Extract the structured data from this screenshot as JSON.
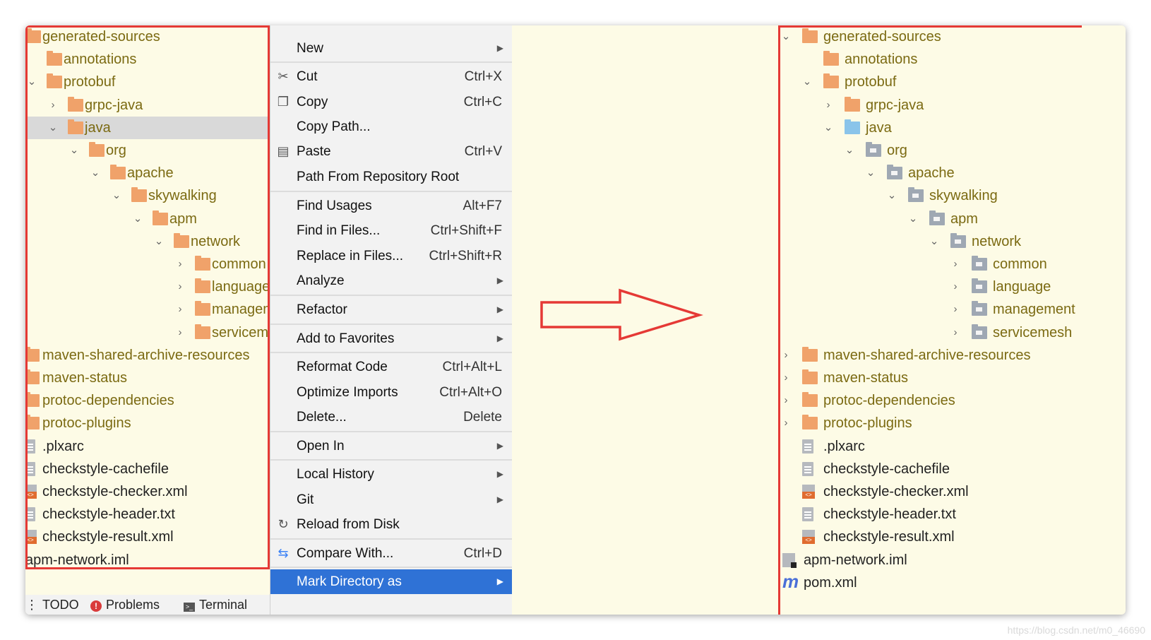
{
  "left_tree": {
    "rows": [
      {
        "label": "generated-sources",
        "icon": "folder-icon"
      },
      {
        "label": "annotations",
        "icon": "folder-icon"
      },
      {
        "label": "protobuf",
        "icon": "folder-icon",
        "chev": "v"
      },
      {
        "label": "grpc-java",
        "icon": "folder-icon",
        "chev": ">"
      },
      {
        "label": "java",
        "icon": "folder-icon",
        "chev": "v"
      },
      {
        "label": "org",
        "icon": "folder-icon",
        "chev": "v"
      },
      {
        "label": "apache",
        "icon": "folder-icon",
        "chev": "v"
      },
      {
        "label": "skywalking",
        "icon": "folder-icon",
        "chev": "v"
      },
      {
        "label": "apm",
        "icon": "folder-icon",
        "chev": "v"
      },
      {
        "label": "network",
        "icon": "folder-icon",
        "chev": "v"
      },
      {
        "label": "common",
        "icon": "folder-icon",
        "chev": ">"
      },
      {
        "label": "language",
        "icon": "folder-icon",
        "chev": ">"
      },
      {
        "label": "managem",
        "icon": "folder-icon",
        "chev": ">"
      },
      {
        "label": "serviceme",
        "icon": "folder-icon",
        "chev": ">"
      },
      {
        "label": "maven-shared-archive-resources",
        "icon": "folder-icon"
      },
      {
        "label": "maven-status",
        "icon": "folder-icon"
      },
      {
        "label": "protoc-dependencies",
        "icon": "folder-icon"
      },
      {
        "label": "protoc-plugins",
        "icon": "folder-icon"
      },
      {
        "label": ".plxarc",
        "icon": "file-icon"
      },
      {
        "label": "checkstyle-cachefile",
        "icon": "file-icon"
      },
      {
        "label": "checkstyle-checker.xml",
        "icon": "xml-file-icon"
      },
      {
        "label": "checkstyle-header.txt",
        "icon": "file-icon"
      },
      {
        "label": "checkstyle-result.xml",
        "icon": "xml-file-icon"
      },
      {
        "label": "apm-network.iml",
        "icon": "none"
      }
    ]
  },
  "bottom_bar": {
    "todo": "TODO",
    "problems": "Problems",
    "terminal": "Terminal"
  },
  "menu": {
    "items": [
      {
        "label": "New",
        "submenu": true
      },
      {
        "label": "Cut",
        "shortcut": "Ctrl+X",
        "icon": "scissors-icon"
      },
      {
        "label": "Copy",
        "shortcut": "Ctrl+C",
        "icon": "copy-icon"
      },
      {
        "label": "Copy Path...",
        "shortcut": ""
      },
      {
        "label": "Paste",
        "shortcut": "Ctrl+V",
        "icon": "clipboard-icon"
      },
      {
        "label": "Path From Repository Root",
        "shortcut": ""
      },
      {
        "label": "Find Usages",
        "shortcut": "Alt+F7"
      },
      {
        "label": "Find in Files...",
        "shortcut": "Ctrl+Shift+F"
      },
      {
        "label": "Replace in Files...",
        "shortcut": "Ctrl+Shift+R"
      },
      {
        "label": "Analyze",
        "submenu": true
      },
      {
        "label": "Refactor",
        "submenu": true
      },
      {
        "label": "Add to Favorites",
        "submenu": true
      },
      {
        "label": "Reformat Code",
        "shortcut": "Ctrl+Alt+L"
      },
      {
        "label": "Optimize Imports",
        "shortcut": "Ctrl+Alt+O"
      },
      {
        "label": "Delete...",
        "shortcut": "Delete"
      },
      {
        "label": "Open In",
        "submenu": true
      },
      {
        "label": "Local History",
        "submenu": true
      },
      {
        "label": "Git",
        "submenu": true
      },
      {
        "label": "Reload from Disk",
        "icon": "reload-icon"
      },
      {
        "label": "Compare With...",
        "shortcut": "Ctrl+D",
        "icon": "compare-icon"
      },
      {
        "label": "Mark Directory as",
        "submenu": true,
        "active": true
      }
    ]
  },
  "right_tree": {
    "rows": [
      {
        "label": "generated-sources",
        "icon": "folder-icon",
        "chev": "v"
      },
      {
        "label": "annotations",
        "icon": "folder-icon"
      },
      {
        "label": "protobuf",
        "icon": "folder-icon",
        "chev": "v"
      },
      {
        "label": "grpc-java",
        "icon": "folder-icon",
        "chev": ">"
      },
      {
        "label": "java",
        "icon": "source-root-folder-icon",
        "chev": "v"
      },
      {
        "label": "org",
        "icon": "package-icon",
        "chev": "v"
      },
      {
        "label": "apache",
        "icon": "package-icon",
        "chev": "v"
      },
      {
        "label": "skywalking",
        "icon": "package-icon",
        "chev": "v"
      },
      {
        "label": "apm",
        "icon": "package-icon",
        "chev": "v"
      },
      {
        "label": "network",
        "icon": "package-icon",
        "chev": "v"
      },
      {
        "label": "common",
        "icon": "package-icon",
        "chev": ">"
      },
      {
        "label": "language",
        "icon": "package-icon",
        "chev": ">"
      },
      {
        "label": "management",
        "icon": "package-icon",
        "chev": ">"
      },
      {
        "label": "servicemesh",
        "icon": "package-icon",
        "chev": ">"
      },
      {
        "label": "maven-shared-archive-resources",
        "icon": "folder-icon",
        "chev": ">"
      },
      {
        "label": "maven-status",
        "icon": "folder-icon",
        "chev": ">"
      },
      {
        "label": "protoc-dependencies",
        "icon": "folder-icon",
        "chev": ">"
      },
      {
        "label": "protoc-plugins",
        "icon": "folder-icon",
        "chev": ">"
      },
      {
        "label": ".plxarc",
        "icon": "file-icon"
      },
      {
        "label": "checkstyle-cachefile",
        "icon": "file-icon"
      },
      {
        "label": "checkstyle-checker.xml",
        "icon": "xml-file-icon"
      },
      {
        "label": "checkstyle-header.txt",
        "icon": "file-icon"
      },
      {
        "label": "checkstyle-result.xml",
        "icon": "xml-file-icon"
      },
      {
        "label": "apm-network.iml",
        "icon": "iml-file-icon"
      },
      {
        "label": "pom.xml",
        "icon": "maven-icon"
      }
    ]
  },
  "caption": "https://blog.csdn.net/m0_46690",
  "colors": {
    "highlight": "#2f72d6",
    "frame": "#e53935",
    "folder": "#f0a26a",
    "source_root": "#8ac4ea",
    "package": "#9fa8b3",
    "panel": "#fdfbe6"
  }
}
